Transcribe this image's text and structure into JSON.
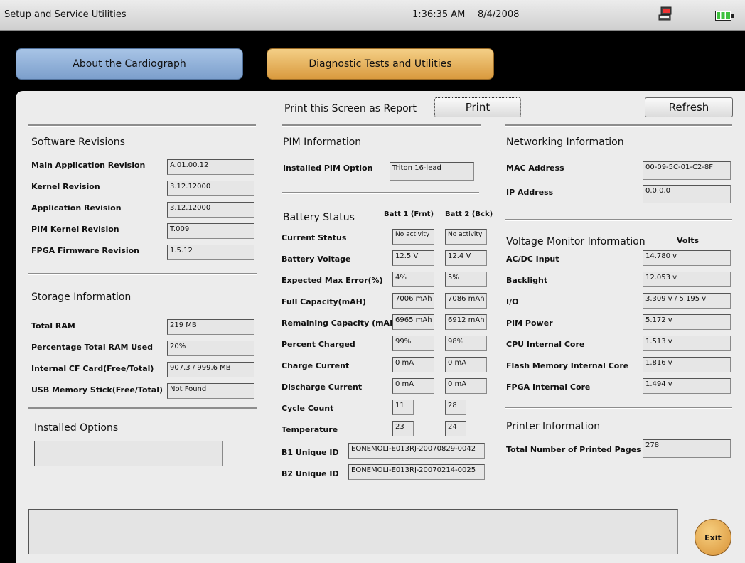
{
  "titlebar": {
    "title": "Setup and Service Utilities",
    "time": "1:36:35 AM",
    "date": "8/4/2008"
  },
  "tabs": {
    "about": "About the Cardiograph",
    "diagnostic": "Diagnostic Tests and Utilities"
  },
  "print": {
    "label": "Print this Screen as Report",
    "button": "Print"
  },
  "refresh": "Refresh",
  "software": {
    "heading": "Software Revisions",
    "rows": [
      {
        "label": "Main Application Revision",
        "value": "A.01.00.12"
      },
      {
        "label": "Kernel Revision",
        "value": "3.12.12000"
      },
      {
        "label": "Application Revision",
        "value": "3.12.12000"
      },
      {
        "label": "PIM Kernel Revision",
        "value": "T.009"
      },
      {
        "label": "FPGA Firmware Revision",
        "value": "1.5.12"
      }
    ]
  },
  "storage": {
    "heading": "Storage Information",
    "rows": [
      {
        "label": "Total RAM",
        "value": "219 MB"
      },
      {
        "label": "Percentage Total RAM Used",
        "value": "20%"
      },
      {
        "label": "Internal CF Card(Free/Total)",
        "value": "907.3 / 999.6 MB"
      },
      {
        "label": "USB Memory Stick(Free/Total)",
        "value": "Not Found"
      }
    ]
  },
  "installed_options": {
    "heading": "Installed Options",
    "value": ""
  },
  "pim": {
    "heading": "PIM Information",
    "label": "Installed PIM Option",
    "value": "Triton 16-lead"
  },
  "battery": {
    "heading": "Battery Status",
    "col1": "Batt 1 (Frnt)",
    "col2": "Batt 2 (Bck)",
    "rows": [
      {
        "label": "Current Status",
        "b1": "No activity",
        "b2": "No activity"
      },
      {
        "label": "Battery Voltage",
        "b1": "12.5 V",
        "b2": "12.4 V"
      },
      {
        "label": "Expected Max Error(%)",
        "b1": "4%",
        "b2": "5%"
      },
      {
        "label": "Full Capacity(mAH)",
        "b1": "7006 mAh",
        "b2": "7086 mAh"
      },
      {
        "label": "Remaining Capacity (mAH)",
        "b1": "6965 mAh",
        "b2": "6912 mAh"
      },
      {
        "label": "Percent Charged",
        "b1": "99%",
        "b2": "98%"
      },
      {
        "label": "Charge Current",
        "b1": "0 mA",
        "b2": "0 mA"
      },
      {
        "label": "Discharge Current",
        "b1": "0 mA",
        "b2": "0 mA"
      },
      {
        "label": "Cycle Count",
        "b1": "11",
        "b2": "28"
      },
      {
        "label": "Temperature",
        "b1": "23",
        "b2": "24"
      }
    ],
    "ids": [
      {
        "label": "B1 Unique ID",
        "value": "EONEMOLI-E013RJ-20070829-0042"
      },
      {
        "label": "B2 Unique ID",
        "value": "EONEMOLI-E013RJ-20070214-0025"
      }
    ]
  },
  "network": {
    "heading": "Networking Information",
    "rows": [
      {
        "label": "MAC Address",
        "value": "00-09-5C-01-C2-8F"
      },
      {
        "label": "IP Address",
        "value": "0.0.0.0"
      }
    ]
  },
  "voltage": {
    "heading": "Voltage Monitor Information",
    "unit": "Volts",
    "rows": [
      {
        "label": "AC/DC Input",
        "value": "14.780 v"
      },
      {
        "label": "Backlight",
        "value": "12.053 v"
      },
      {
        "label": "I/O",
        "value": "3.309 v / 5.195 v"
      },
      {
        "label": "PIM Power",
        "value": "5.172 v"
      },
      {
        "label": "CPU Internal Core",
        "value": "1.513 v"
      },
      {
        "label": "Flash Memory Internal Core",
        "value": "1.816 v"
      },
      {
        "label": "FPGA Internal Core",
        "value": "1.494 v"
      }
    ]
  },
  "printer": {
    "heading": "Printer Information",
    "label": "Total Number of Printed Pages",
    "value": "278"
  },
  "message": "",
  "exit": "Exit",
  "icons": {
    "network": "network-computer-icon",
    "battery": "battery-full-icon"
  },
  "colors": {
    "about_tab": "#8fb0da",
    "diagnostic_tab": "#e8b660",
    "exit_button": "#e2a84a",
    "battery": "#3ec13e"
  }
}
